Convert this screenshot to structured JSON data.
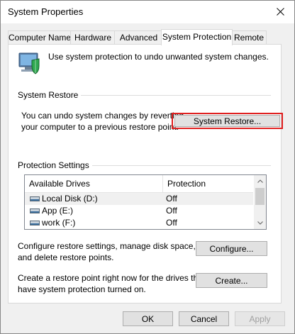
{
  "window": {
    "title": "System Properties",
    "close_glyph": "✕"
  },
  "tabs": [
    {
      "label": "Computer Name",
      "active": false
    },
    {
      "label": "Hardware",
      "active": false
    },
    {
      "label": "Advanced",
      "active": false
    },
    {
      "label": "System Protection",
      "active": true
    },
    {
      "label": "Remote",
      "active": false
    }
  ],
  "intro": {
    "icon": "computer-shield-icon",
    "text": "Use system protection to undo unwanted system changes."
  },
  "system_restore": {
    "group_label": "System Restore",
    "description_line1": "You can undo system changes by reverting",
    "description_line2": "your computer to a previous restore point.",
    "button_label": "System Restore...",
    "highlight_color": "#e02020"
  },
  "protection_settings": {
    "group_label": "Protection Settings",
    "columns": [
      "Available Drives",
      "Protection"
    ],
    "drives": [
      {
        "name": "Local Disk (D:)",
        "protection": "Off",
        "icon": "drive-icon"
      },
      {
        "name": "App (E:)",
        "protection": "Off",
        "icon": "drive-icon"
      },
      {
        "name": "work (F:)",
        "protection": "Off",
        "icon": "drive-icon"
      }
    ],
    "configure_text_line1": "Configure restore settings, manage disk space,",
    "configure_text_line2": "and delete restore points.",
    "configure_button": "Configure...",
    "create_text_line1": "Create a restore point right now for the drives that",
    "create_text_line2": "have system protection turned on.",
    "create_button": "Create..."
  },
  "footer": {
    "ok": "OK",
    "cancel": "Cancel",
    "apply": "Apply"
  }
}
